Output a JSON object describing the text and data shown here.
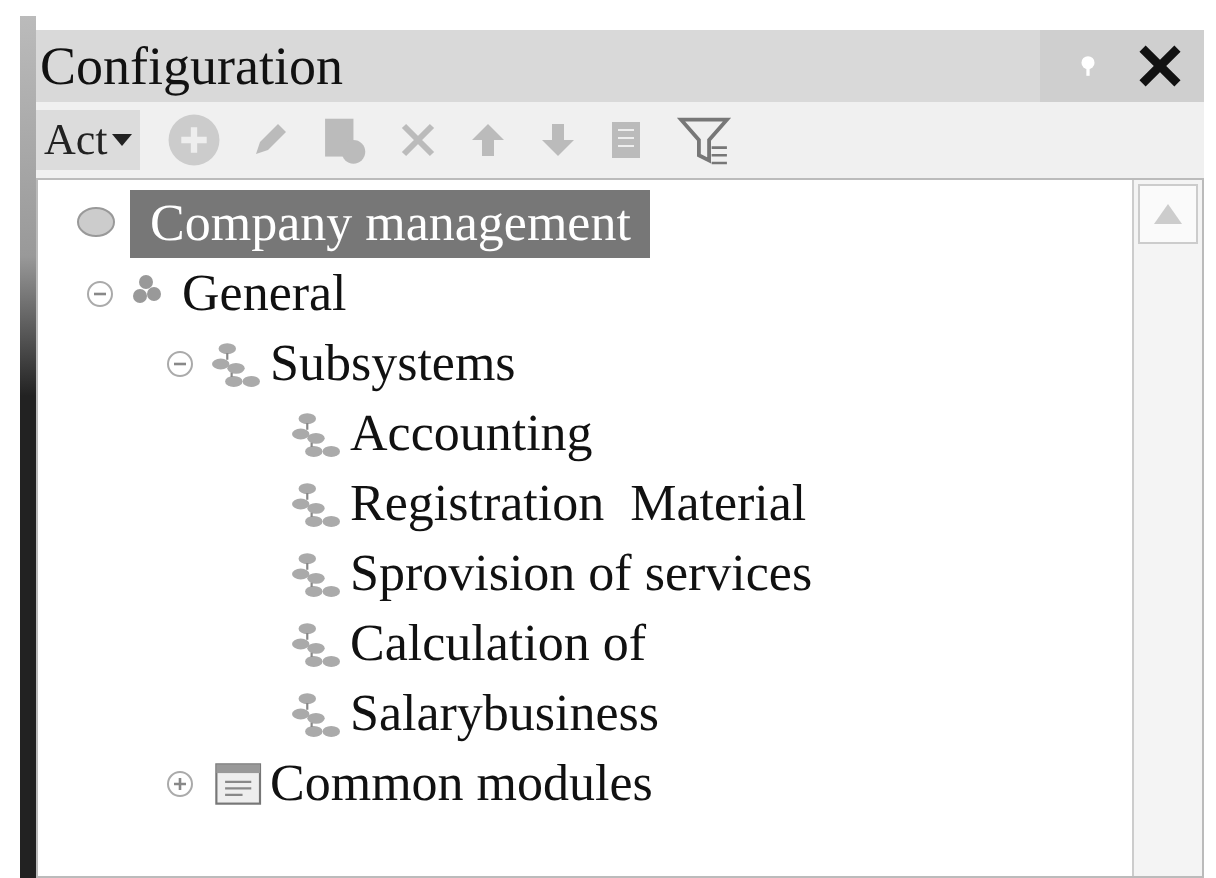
{
  "panel": {
    "title": "Configuration",
    "toolbar": {
      "actions_menu": "Act",
      "buttons": [
        {
          "kind": "add",
          "disabled": true
        },
        {
          "kind": "edit",
          "disabled": true
        },
        {
          "kind": "copy",
          "disabled": true
        },
        {
          "kind": "delete",
          "disabled": true
        },
        {
          "kind": "up",
          "disabled": true
        },
        {
          "kind": "down",
          "disabled": true
        },
        {
          "kind": "list",
          "disabled": true
        },
        {
          "kind": "filter",
          "disabled": false
        }
      ]
    },
    "tree": [
      {
        "label": "Company management",
        "kind": "root",
        "selected": true
      },
      {
        "label": "General",
        "kind": "group",
        "selected": false,
        "expanded": true,
        "children": [
          {
            "label": "Subsystems",
            "kind": "subsystem",
            "selected": false,
            "expanded": true,
            "children": [
              {
                "label": "Accounting",
                "kind": "subsystem",
                "selected": false
              },
              {
                "label": "Registration  Material",
                "kind": "subsystem",
                "selected": false
              },
              {
                "label": "Sprovision of services",
                "kind": "subsystem",
                "selected": false
              },
              {
                "label": "Calculation of",
                "kind": "subsystem",
                "selected": false
              },
              {
                "label": "Salarybusiness",
                "kind": "subsystem",
                "selected": false
              }
            ]
          },
          {
            "label": "Common modules",
            "kind": "modules",
            "selected": false,
            "expanded": false
          }
        ]
      }
    ]
  }
}
